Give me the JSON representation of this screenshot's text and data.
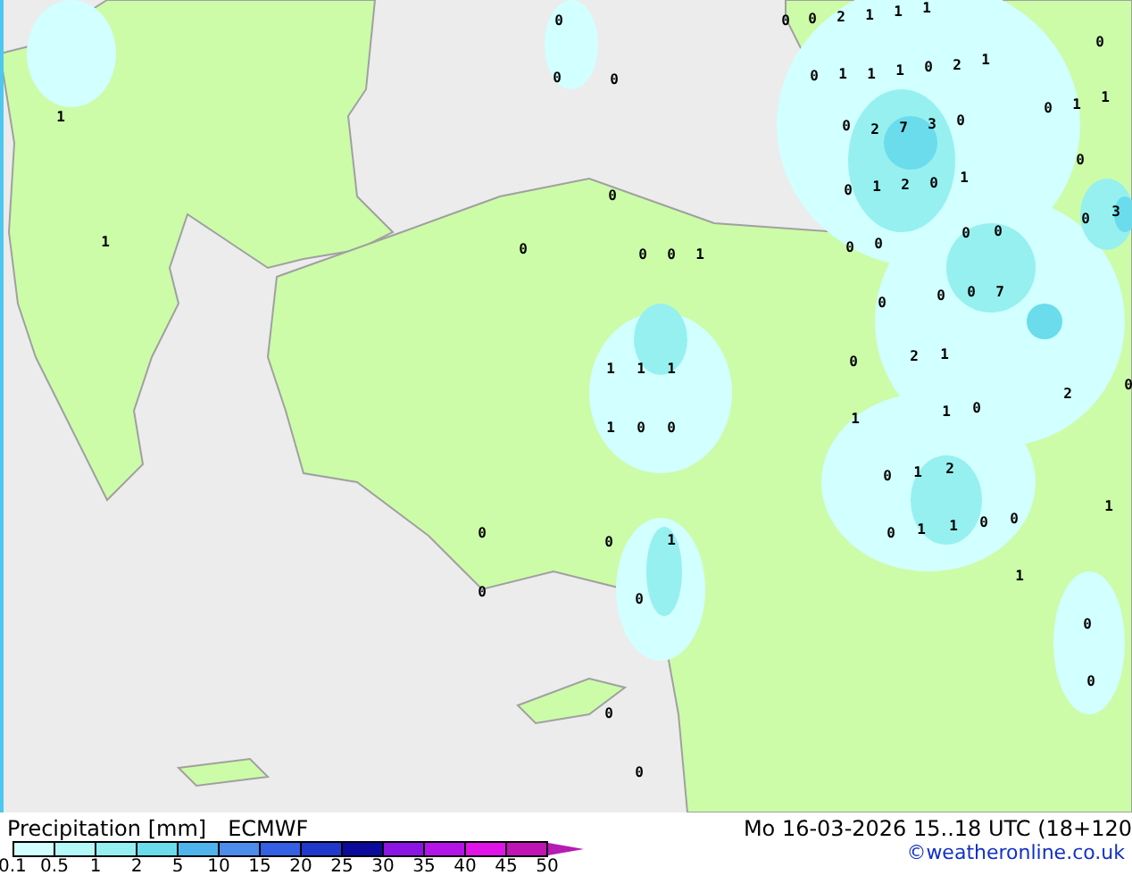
{
  "map": {
    "value_labels": [
      "0",
      "0",
      "0",
      "2",
      "1",
      "1",
      "1",
      "0",
      "0",
      "0",
      "0",
      "1",
      "1",
      "1",
      "0",
      "2",
      "1",
      "1",
      "0",
      "2",
      "7",
      "3",
      "0",
      "0",
      "1",
      "1",
      "0",
      "0",
      "0",
      "1",
      "2",
      "0",
      "1",
      "0",
      "3",
      "1",
      "0",
      "0",
      "0",
      "1",
      "0",
      "0",
      "0",
      "0",
      "0",
      "0",
      "0",
      "7",
      "1",
      "1",
      "1",
      "0",
      "2",
      "1",
      "2",
      "0",
      "1",
      "0",
      "0",
      "1",
      "1",
      "0",
      "0",
      "1",
      "2",
      "1",
      "0",
      "0",
      "1",
      "0",
      "1",
      "1",
      "0",
      "0",
      "0",
      "0",
      "1",
      "0",
      "0",
      "0",
      "0"
    ]
  },
  "legend": {
    "title": "Precipitation [mm]",
    "model": "ECMWF",
    "bins": [
      {
        "color": "#d2ffff"
      },
      {
        "color": "#b4f8f8"
      },
      {
        "color": "#96f0f0"
      },
      {
        "color": "#6adcec"
      },
      {
        "color": "#50b4ec"
      },
      {
        "color": "#4c8cec"
      },
      {
        "color": "#3460e4"
      },
      {
        "color": "#2038cc"
      },
      {
        "color": "#0a0a9c"
      },
      {
        "color": "#8c14e4"
      },
      {
        "color": "#b414e8"
      },
      {
        "color": "#e014e8"
      },
      {
        "color": "#c014b4"
      }
    ],
    "ticks": [
      "0.1",
      "0.5",
      "1",
      "2",
      "5",
      "10",
      "15",
      "20",
      "25",
      "30",
      "35",
      "40",
      "45",
      "50"
    ]
  },
  "valid_time": "Mo 16-03-2026 15..18 UTC (18+120",
  "credit": "©weatheronline.co.uk"
}
